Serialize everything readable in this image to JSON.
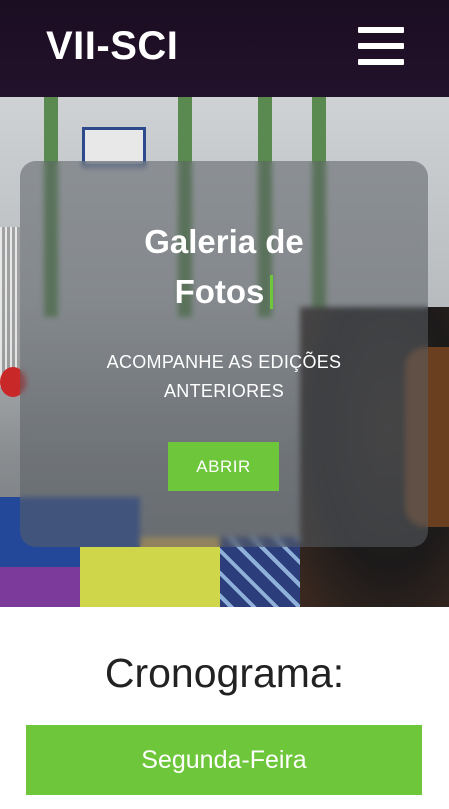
{
  "header": {
    "logo": "VII-SCI",
    "menu_icon": "hamburger-menu-icon"
  },
  "hero": {
    "title_line1": "Galeria de",
    "title_line2": "Fotos",
    "subtitle_line1": "ACOMPANHE AS EDIÇÕES",
    "subtitle_line2": "ANTERIORES",
    "button_label": "ABRIR"
  },
  "schedule": {
    "title": "Cronograma:",
    "day_button": "Segunda-Feira"
  },
  "colors": {
    "header_bg": "#1b0d22",
    "accent_green": "#6ec63a",
    "text_dark": "#222222"
  }
}
